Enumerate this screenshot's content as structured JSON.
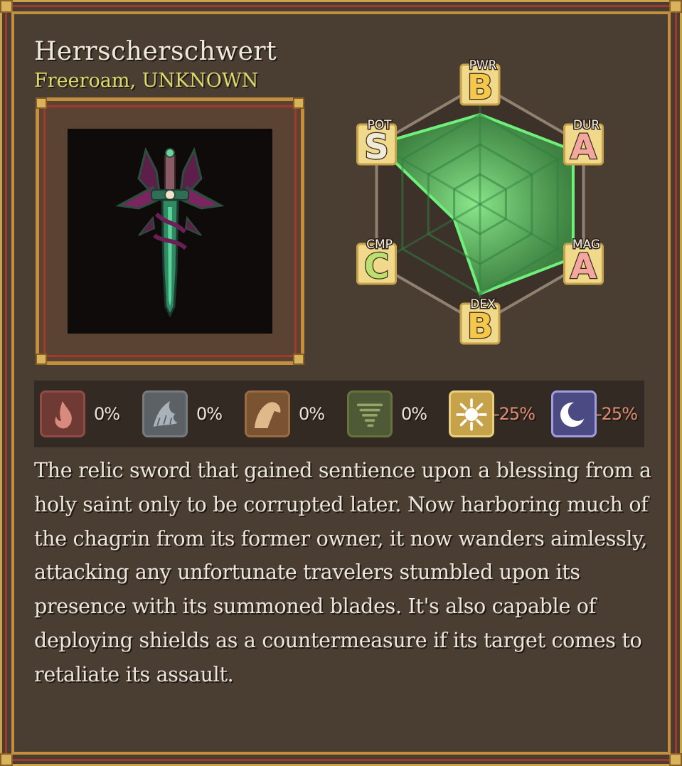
{
  "item": {
    "name": "Herrscherschwert",
    "location": "Freeroam, UNKNOWN",
    "portrait_icon": "corrupted-sword-icon"
  },
  "stats": [
    {
      "abbr": "PWR",
      "grade": "B",
      "value": 0.75
    },
    {
      "abbr": "DUR",
      "grade": "A",
      "value": 0.9
    },
    {
      "abbr": "MAG",
      "grade": "A",
      "value": 0.9
    },
    {
      "abbr": "DEX",
      "grade": "B",
      "value": 0.75
    },
    {
      "abbr": "CMP",
      "grade": "C",
      "value": 0.25
    },
    {
      "abbr": "POT",
      "grade": "S",
      "value": 1.0
    }
  ],
  "colors": {
    "grade_S": "#f0ead8",
    "grade_A": "#f3a7a0",
    "grade_B": "#f5c84a",
    "grade_C": "#b9e070",
    "radar_fill": "#4fbf57",
    "radar_stroke": "#6ef07a",
    "resist_positive": "#ece4d8",
    "resist_negative": "#e08a74"
  },
  "resistances": [
    {
      "element": "fire",
      "icon": "fire-icon",
      "value": "0%",
      "bg": "#6f3a34",
      "border": "#8f4c44"
    },
    {
      "element": "water",
      "icon": "water-icon",
      "value": "0%",
      "bg": "#5c6165",
      "border": "#767b80"
    },
    {
      "element": "earth",
      "icon": "earth-icon",
      "value": "0%",
      "bg": "#7a5333",
      "border": "#9a6a42"
    },
    {
      "element": "wind",
      "icon": "wind-icon",
      "value": "0%",
      "bg": "#4e5a35",
      "border": "#66733f"
    },
    {
      "element": "light",
      "icon": "light-icon",
      "value": "-25%",
      "bg": "#c6a34a",
      "border": "#e8cf7e"
    },
    {
      "element": "dark",
      "icon": "dark-icon",
      "value": "-25%",
      "bg": "#4c4a82",
      "border": "#9f9ce0"
    }
  ],
  "description": "The relic sword that gained sentience upon a blessing from a holy saint only to be corrupted later. Now harboring much of the chagrin from its former owner, it now wanders aimlessly, attacking any unfortunate travelers stumbled upon its presence with its summoned blades. It's also capable of deploying shields as a countermeasure if its target comes to retaliate its assault."
}
